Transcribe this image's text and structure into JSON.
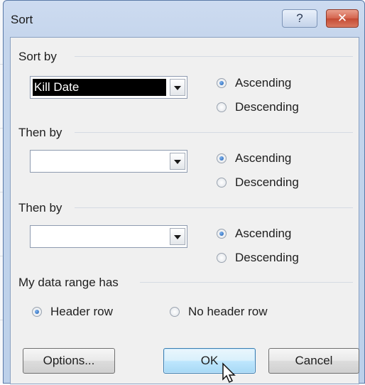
{
  "window": {
    "title": "Sort",
    "help_label": "?",
    "close_label": "✕"
  },
  "groups": [
    {
      "label": "Sort by",
      "combo_value": "Kill Date",
      "ascending": "Ascending",
      "descending": "Descending",
      "selected": "ascending"
    },
    {
      "label": "Then by",
      "combo_value": "",
      "ascending": "Ascending",
      "descending": "Descending",
      "selected": "ascending"
    },
    {
      "label": "Then by",
      "combo_value": "",
      "ascending": "Ascending",
      "descending": "Descending",
      "selected": "ascending"
    }
  ],
  "header_group": {
    "label": "My data range has",
    "header_row": "Header row",
    "no_header_row": "No header row",
    "selected": "header_row"
  },
  "buttons": {
    "options": "Options...",
    "ok": "OK",
    "cancel": "Cancel"
  },
  "colors": {
    "title_bg": "#c4d5ec",
    "client_bg": "#f0f0f0",
    "close_red": "#c44a33",
    "selection": "#000000",
    "radio_accent": "#1f5fb0"
  }
}
